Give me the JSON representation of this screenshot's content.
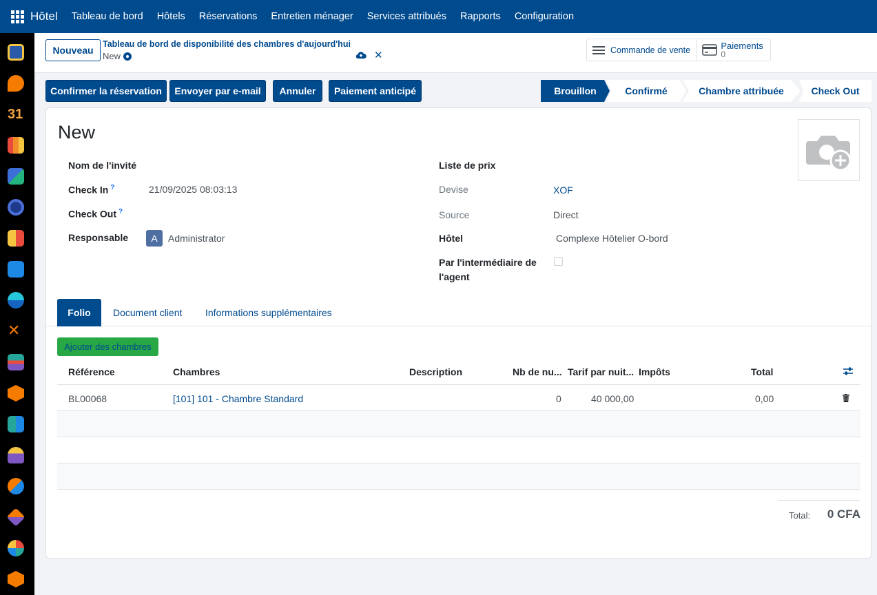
{
  "topbar": {
    "app_name": "Hôtel",
    "menu": [
      "Tableau de bord",
      "Hôtels",
      "Réservations",
      "Entretien ménager",
      "Services attribués",
      "Rapports",
      "Configuration"
    ]
  },
  "control": {
    "new_button": "Nouveau",
    "breadcrumb": "Tableau de bord de disponibilité des chambres d'aujourd'hui",
    "record_name": "New",
    "smart_buttons": {
      "sale_order": "Commande de vente",
      "payments_label": "Paiements",
      "payments_count": "0"
    }
  },
  "actions": {
    "confirm": "Confirmer la réservation",
    "email": "Envoyer par e-mail",
    "cancel": "Annuler",
    "advance": "Paiement anticipé"
  },
  "stages": [
    "Brouillon",
    "Confirmé",
    "Chambre attribuée",
    "Check Out"
  ],
  "form": {
    "title": "New",
    "fields": {
      "guest_label": "Nom de l'invité",
      "checkin_label": "Check In",
      "checkin_value": "21/09/2025 08:03:13",
      "checkout_label": "Check Out",
      "responsible_label": "Responsable",
      "responsible_initial": "A",
      "responsible_value": "Administrator",
      "pricelist_label": "Liste de prix",
      "currency_label": "Devise",
      "currency_value": "XOF",
      "source_label": "Source",
      "source_value": "Direct",
      "hotel_label": "Hôtel",
      "hotel_value": "Complexe Hôtelier O-bord",
      "agent_label_1": "Par l'intermédiaire de",
      "agent_label_2": "l'agent",
      "help_mark": "?"
    }
  },
  "tabs": [
    "Folio",
    "Document client",
    "Informations supplémentaires"
  ],
  "folio": {
    "add_button": "Ajouter des chambres",
    "columns": [
      "Référence",
      "Chambres",
      "Description",
      "Nb de nu...",
      "Tarif par nuit...",
      "Impôts",
      "Total"
    ],
    "rows": [
      {
        "reference": "BL00068",
        "room": "[101] 101 - Chambre Standard",
        "description": "",
        "nights": "0",
        "rate": "40 000,00",
        "taxes": "",
        "total": "0,00"
      }
    ],
    "total_label": "Total:",
    "total_value": "0 CFA"
  },
  "colors": {
    "primary": "#004a8e",
    "success": "#28a745"
  }
}
